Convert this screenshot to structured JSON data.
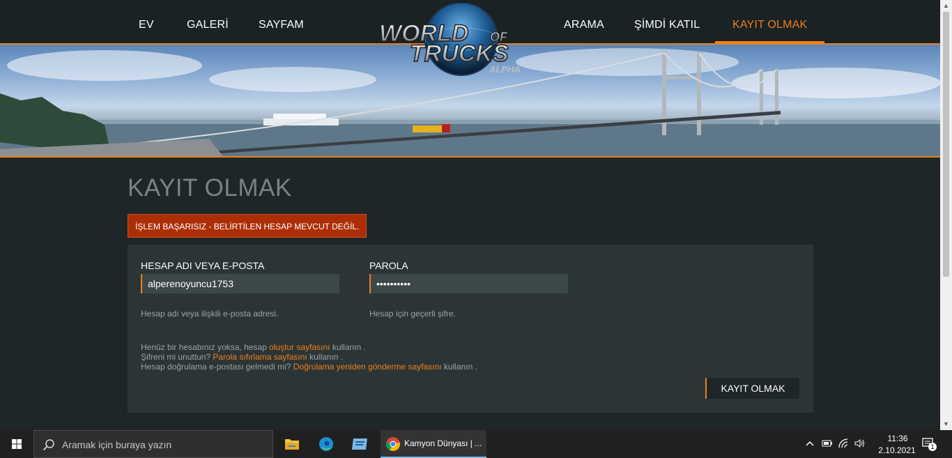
{
  "nav": {
    "left": [
      "EV",
      "GALERİ",
      "SAYFAM"
    ],
    "right": [
      "ARAMA",
      "ŞİMDİ KATIL",
      "KAYIT OLMAK"
    ],
    "active": "KAYIT OLMAK"
  },
  "logo": {
    "line1": "WORLD",
    "of": "OF",
    "line2": "TRUCKS",
    "sub": "ALPHA"
  },
  "page": {
    "title": "KAYIT OLMAK",
    "error": "İŞLEM BAŞARISIZ - BELİRTİLEN HESAP MEVCUT DEĞİL."
  },
  "form": {
    "username_label": "HESAP ADI VEYA E-POSTA",
    "username_value": "alperenoyuncu1753",
    "username_hint": "Hesap adı veya ilişkili e-posta adresi.",
    "password_label": "PAROLA",
    "password_value": "••••••••••",
    "password_hint": "Hesap için geçerli şifre.",
    "info": [
      {
        "pre": "Henüz bir hesabınız yoksa, hesap ",
        "link": "oluştur sayfasını",
        "post": " kullanın ."
      },
      {
        "pre": "Şifreni mi unuttun? ",
        "link": "Parola sıfırlama sayfasını",
        "post": " kullanın ."
      },
      {
        "pre": "Hesap doğrulama e-postası gelmedi mi? ",
        "link": "Doğrulama yeniden gönderme sayfasını",
        "post": " kullanın ."
      }
    ],
    "submit_label": "KAYIT OLMAK"
  },
  "taskbar": {
    "search_placeholder": "Aramak için buraya yazın",
    "chrome_label": "Kamyon Dünyası | ...",
    "time": "11:36",
    "date": "2.10.2021",
    "notification_count": "1"
  },
  "colors": {
    "accent": "#ef7f1a",
    "error": "#ac2e07",
    "panel": "#2b3537",
    "background": "#1e2628"
  }
}
